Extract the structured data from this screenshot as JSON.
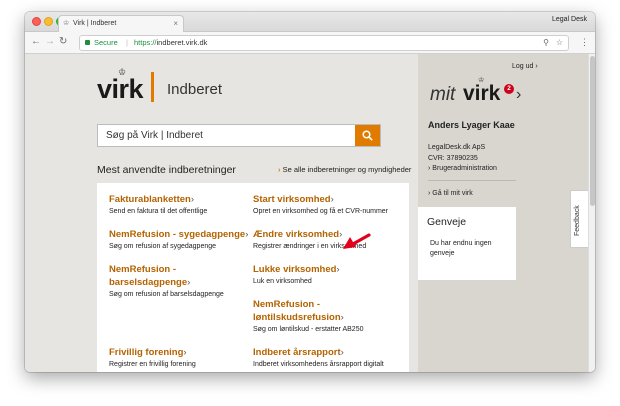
{
  "browser": {
    "tab_title": "Virk | Indberet",
    "tab_close": "×",
    "profile_name": "Legal Desk",
    "secure_label": "Secure",
    "url_scheme": "https://",
    "url_host": "indberet.virk.dk",
    "traffic_colors": [
      "#fc5f57",
      "#fdbc2e",
      "#33c748"
    ]
  },
  "header": {
    "logo_text": "virk",
    "logo_sub": "Indberet",
    "brand_color": "#e07b00",
    "search_placeholder": "Søg på Virk | Indberet"
  },
  "main": {
    "section_title": "Mest anvendte indberetninger",
    "see_all": "Se alle indberetninger og myndigheder",
    "items": [
      {
        "title": "Fakturablanketten",
        "desc": "Send en faktura til det offentlige"
      },
      {
        "title": "Start virksomhed",
        "desc": "Opret en virksomhed og få et CVR-nummer"
      },
      {
        "title": "NemRefusion - sygedagpenge",
        "desc": "Søg om refusion af sygedagpenge"
      },
      {
        "title": "Ændre virksomhed",
        "desc": "Registrer ændringer i en virksomhed"
      },
      {
        "title_line1": "NemRefusion -",
        "title_line2": "barselsdagpenge",
        "desc": "Søg om refusion af barselsdagpenge"
      },
      {
        "title": "Lukke virksomhed",
        "desc": "Luk en virksomhed"
      },
      {
        "title_line1": "NemRefusion -",
        "title_line2": "løntilskudsrefusion",
        "desc": "Søg om løntilskud - erstatter AB250"
      },
      {
        "title": "Frivillig forening",
        "desc": "Registrer en frivillig forening"
      },
      {
        "title": "Indberet årsrapport",
        "desc": "Indberet virksomhedens årsrapport digitalt"
      }
    ]
  },
  "sidebar": {
    "logout": "Log ud",
    "mit": "mit",
    "virk": "virk",
    "badge_count": "2",
    "user_name": "Anders Lyager Kaae",
    "company": "LegalDesk.dk ApS",
    "cvr": "CVR: 37890235",
    "user_admin": "Brugeradministration",
    "goto_mit_virk": "Gå til mit virk",
    "genveje_title": "Genveje",
    "genveje_text": "Du har endnu ingen genveje"
  },
  "feedback_label": "Feedback"
}
